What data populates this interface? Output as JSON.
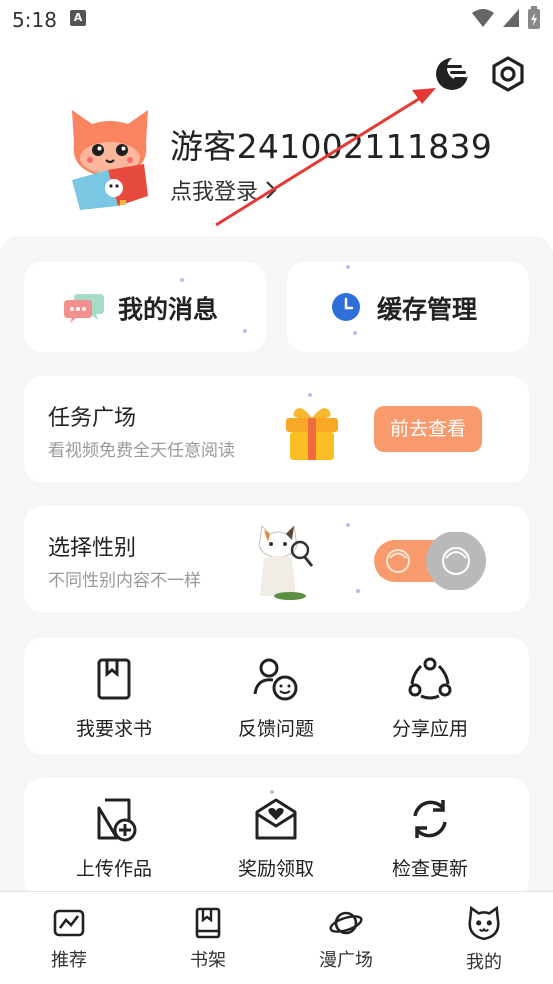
{
  "status_bar": {
    "time": "5:18",
    "badge": "A"
  },
  "profile": {
    "username": "游客241002111839",
    "login_text": "点我登录"
  },
  "header_icons": [
    "theme-moon-icon",
    "settings-gear-icon"
  ],
  "quick_actions": [
    {
      "label": "我的消息",
      "icon": "chat-bubbles-icon"
    },
    {
      "label": "缓存管理",
      "icon": "clock-icon"
    }
  ],
  "task_card": {
    "title": "任务广场",
    "subtitle": "看视频免费全天任意阅读",
    "button": "前去查看"
  },
  "gender_card": {
    "title": "选择性别",
    "subtitle": "不同性别内容不一样"
  },
  "grid_row1": [
    {
      "label": "我要求书",
      "icon": "book-request-icon"
    },
    {
      "label": "反馈问题",
      "icon": "feedback-person-icon"
    },
    {
      "label": "分享应用",
      "icon": "share-icon"
    }
  ],
  "grid_row2": [
    {
      "label": "上传作品",
      "icon": "upload-doc-icon"
    },
    {
      "label": "奖励领取",
      "icon": "reward-envelope-icon"
    },
    {
      "label": "检查更新",
      "icon": "refresh-icon"
    }
  ],
  "bottom_nav": [
    {
      "label": "推荐",
      "icon": "recommend-icon"
    },
    {
      "label": "书架",
      "icon": "bookshelf-icon"
    },
    {
      "label": "漫广场",
      "icon": "planet-icon"
    },
    {
      "label": "我的",
      "icon": "cat-face-icon"
    }
  ],
  "colors": {
    "accent": "#f99a6c",
    "arrow": "#e53935",
    "background": "#f6f6f8"
  }
}
